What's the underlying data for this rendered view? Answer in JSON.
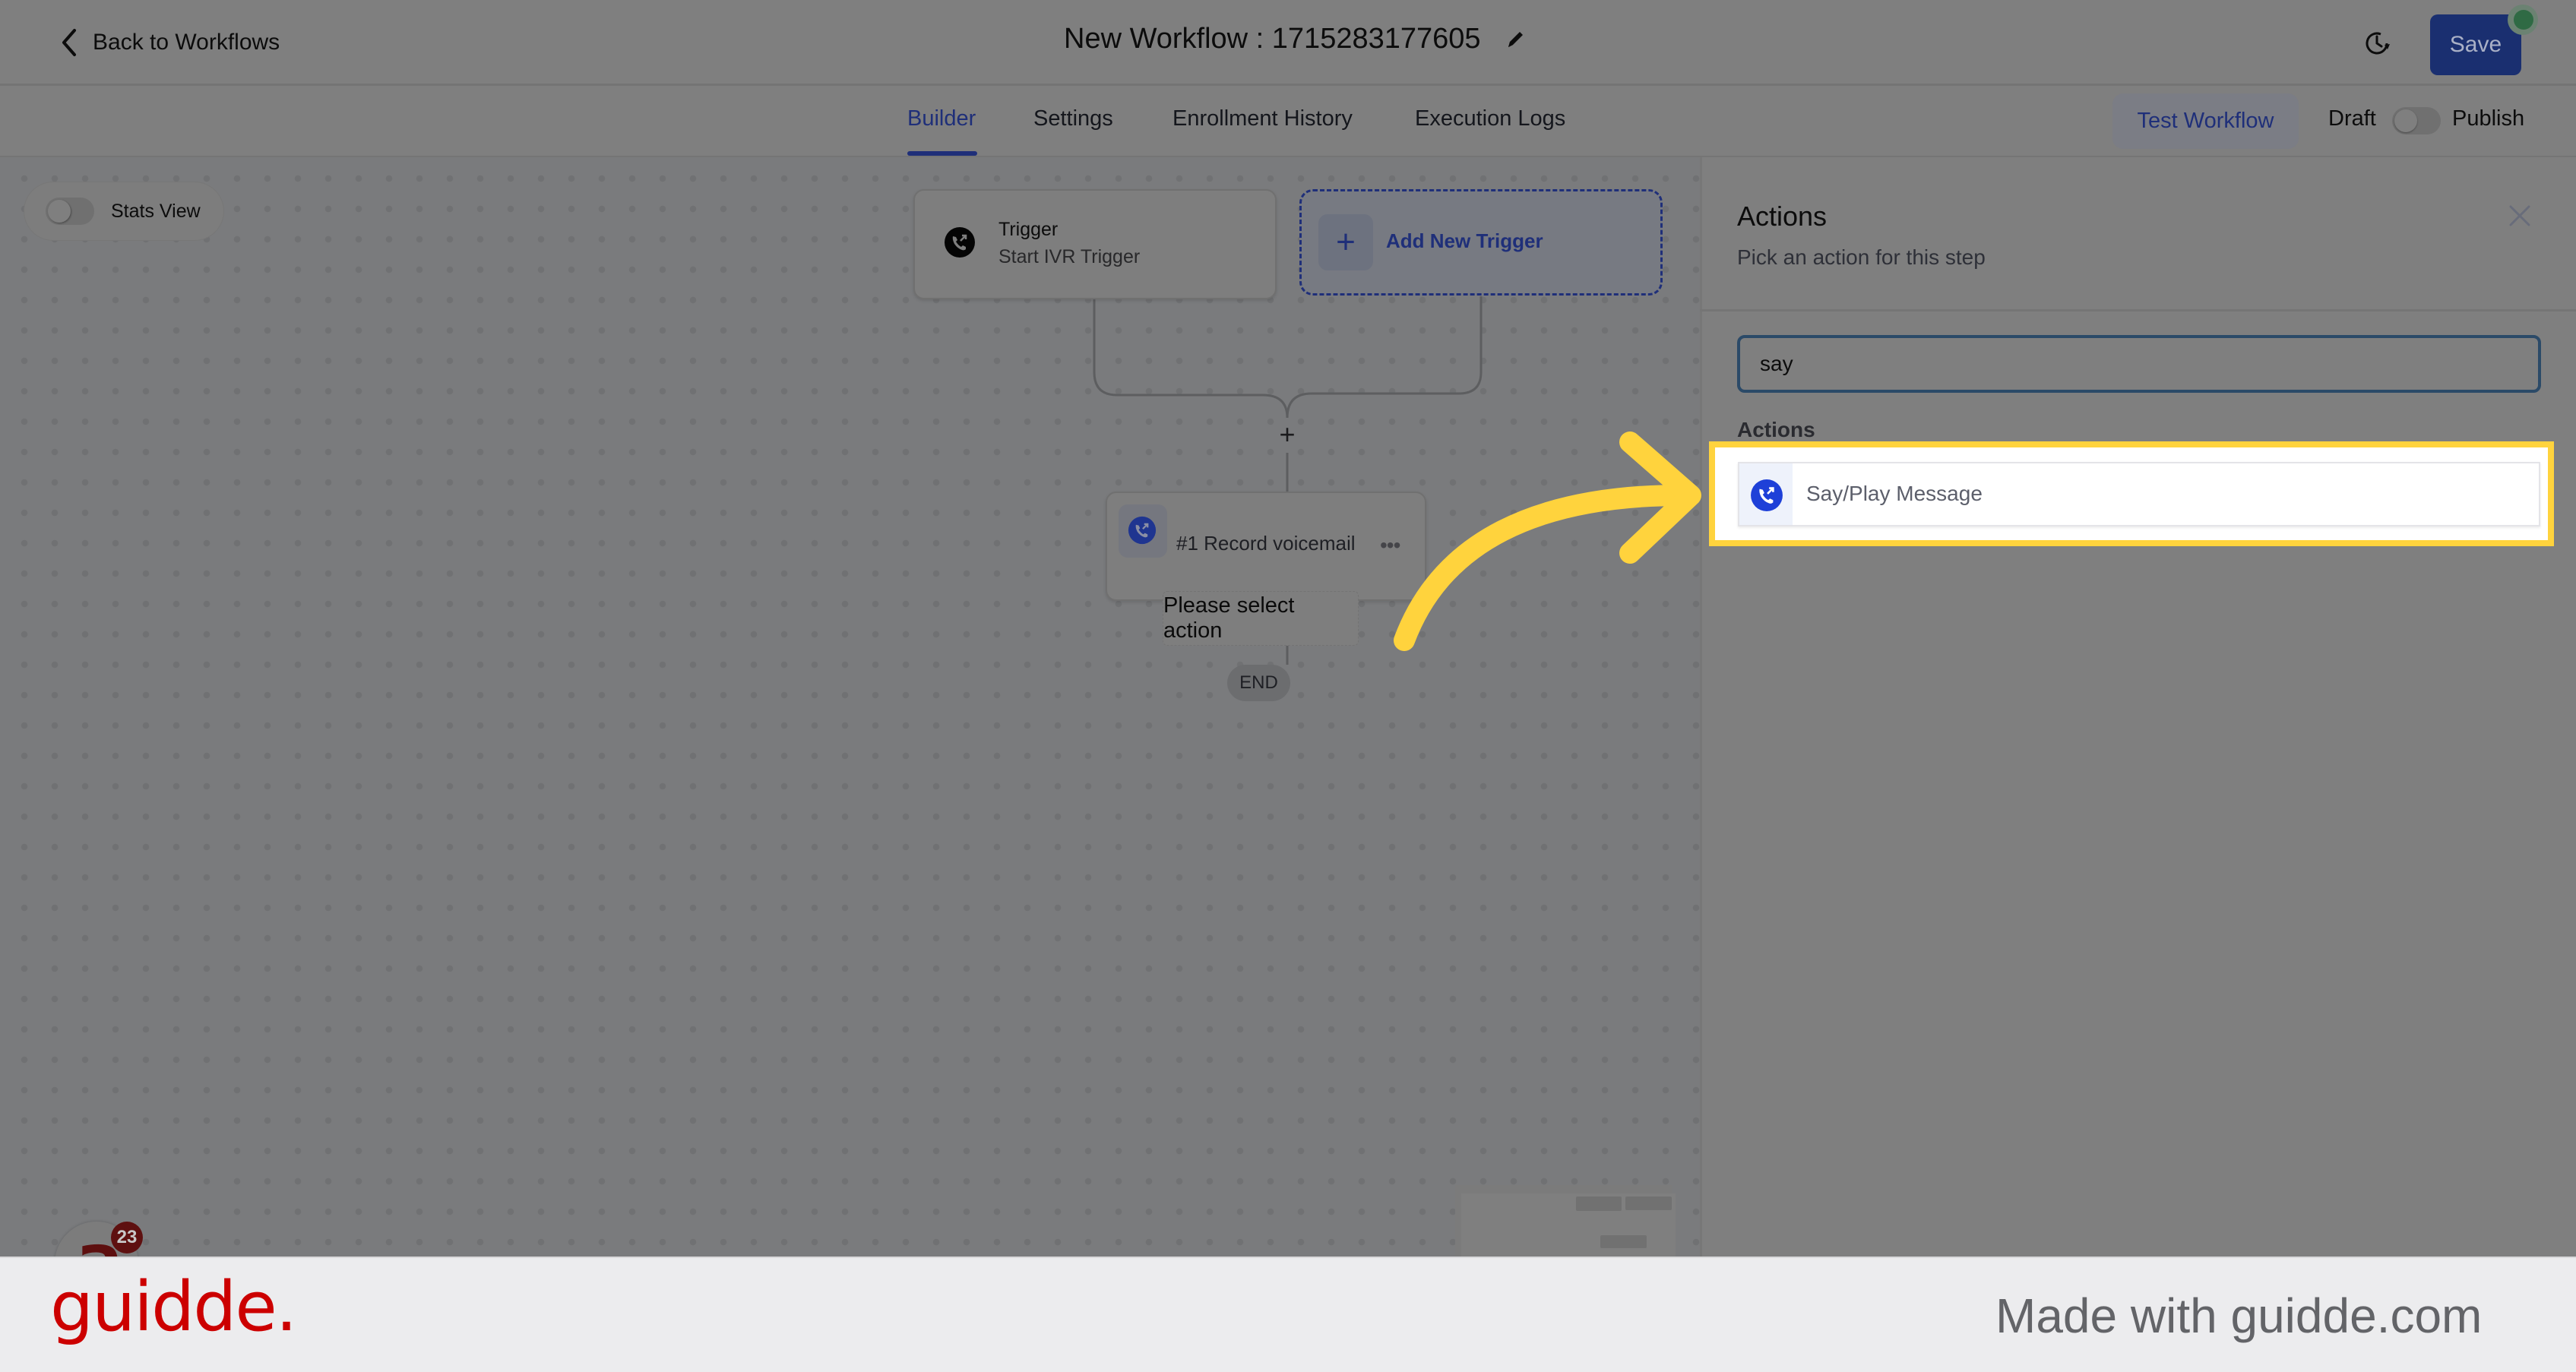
{
  "header": {
    "back_label": "Back to Workflows",
    "title": "New Workflow : 1715283177605",
    "save_label": "Save",
    "status_dot_color": "#2f6a44",
    "brand_color": "#1f2f79"
  },
  "tabs": [
    {
      "label": "Builder",
      "active": true
    },
    {
      "label": "Settings",
      "active": false
    },
    {
      "label": "Enrollment History",
      "active": false
    },
    {
      "label": "Execution Logs",
      "active": false
    }
  ],
  "toolbar": {
    "test_workflow_label": "Test Workflow",
    "draft_label": "Draft",
    "publish_label": "Publish",
    "publish_toggle_on": false
  },
  "canvas": {
    "stats_view_label": "Stats View",
    "stats_view_on": false,
    "trigger": {
      "title": "Trigger",
      "subtitle": "Start IVR Trigger",
      "icon": "phone-forward-icon"
    },
    "add_trigger_label": "Add New Trigger",
    "add_step_symbol": "+",
    "step": {
      "label": "#1 Record voicemail",
      "menu": "•••",
      "icon": "phone-forward-icon"
    },
    "select_action_label": "Please select action",
    "end_label": "END",
    "notification_badge": "23",
    "avatar_letter": "a"
  },
  "panel": {
    "title": "Actions",
    "subtitle": "Pick an action for this step",
    "search_value": "say",
    "section_label": "Actions",
    "results": [
      {
        "label": "Say/Play Message",
        "icon": "phone-forward-icon",
        "highlighted": true
      }
    ],
    "highlight_color": "#ffd33d"
  },
  "footer": {
    "logo": "guidde.",
    "tagline": "Made with guidde.com",
    "logo_color": "#cc0000"
  }
}
